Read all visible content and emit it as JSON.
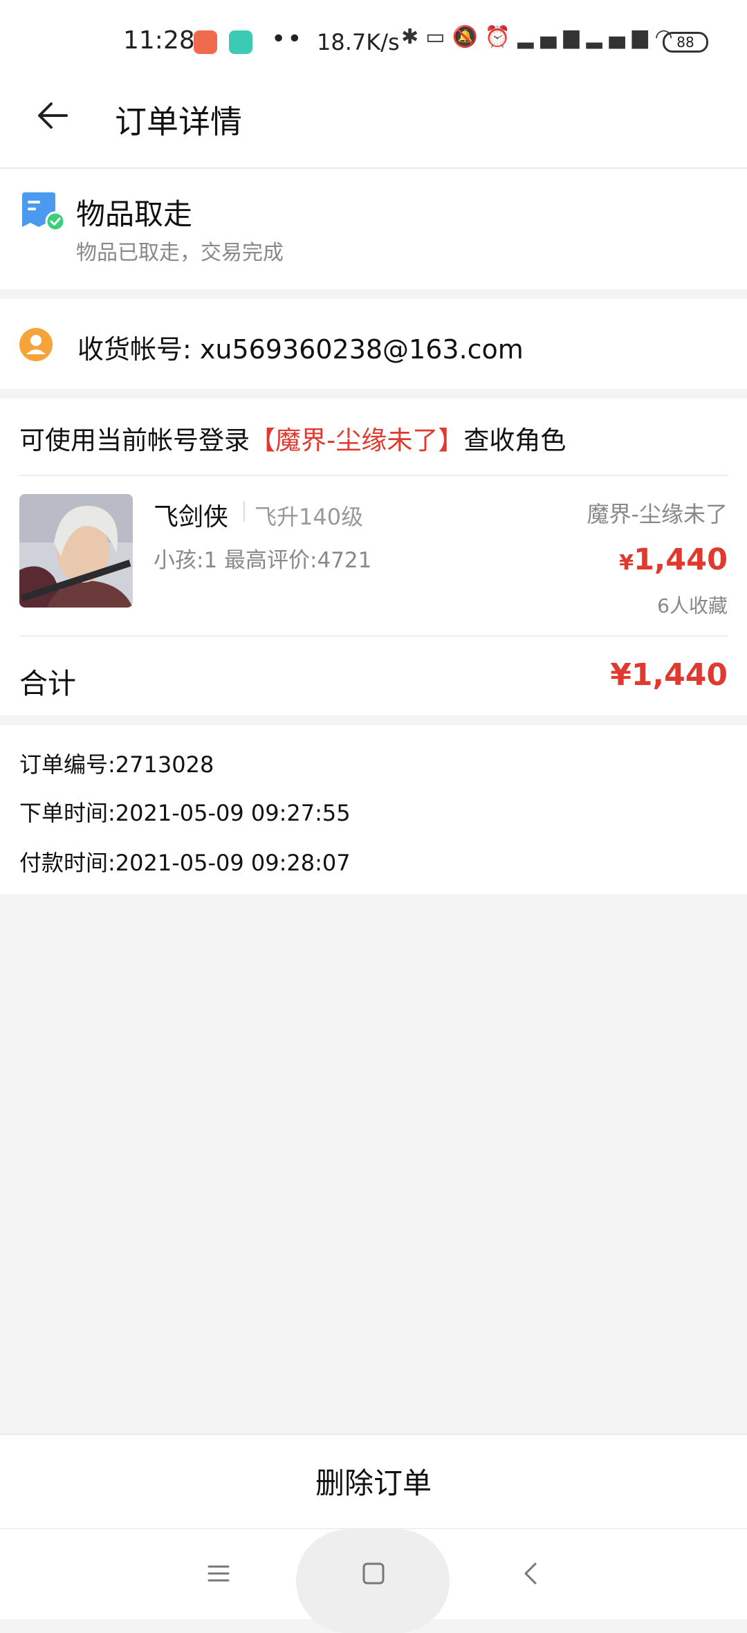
{
  "status_bar": {
    "time": "11:28",
    "dots": "••",
    "net_speed": "18.7K/s",
    "icons": [
      "bluetooth-icon",
      "vibrate-icon",
      "silent-icon",
      "alarm-icon",
      "signal-hd-icon",
      "signal-hd-icon",
      "wifi-icon"
    ],
    "battery": "88"
  },
  "header": {
    "title": "订单详情"
  },
  "order_status": {
    "title": "物品取走",
    "subtitle": "物品已取走，交易完成"
  },
  "account": {
    "label": "收货帐号: xu569360238@163.com"
  },
  "login_hint": {
    "prefix": "可使用当前帐号登录",
    "server": "【魔界-尘缘未了】",
    "suffix": "查收角色"
  },
  "item": {
    "name": "飞剑侠",
    "level": "飞升140级",
    "meta": "小孩:1 最高评价:4721",
    "server": "魔界-尘缘未了",
    "currency": "¥",
    "price": "1,440",
    "favorites": "6人收藏"
  },
  "total": {
    "label": "合计",
    "currency": "¥",
    "price": "1,440"
  },
  "info": {
    "order_no": "订单编号:2713028",
    "order_time": "下单时间:2021-05-09 09:27:55",
    "pay_time": "付款时间:2021-05-09 09:28:07"
  },
  "actions": {
    "delete": "删除订单"
  },
  "colors": {
    "accent_red": "#e03a30",
    "status_blue": "#4a9bf0",
    "status_green": "#3ccf7a",
    "avatar_orange": "#f6a43a"
  }
}
